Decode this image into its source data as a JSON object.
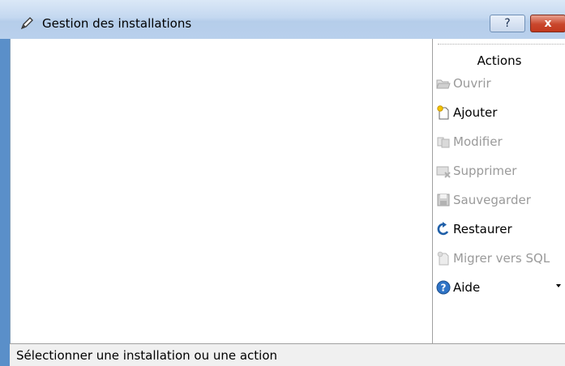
{
  "window": {
    "title": "Gestion des installations",
    "help_glyph": "?",
    "close_glyph": "x"
  },
  "actions": {
    "header": "Actions",
    "items": [
      {
        "label": "Ouvrir",
        "icon": "open-folder-icon",
        "enabled": false
      },
      {
        "label": "Ajouter",
        "icon": "new-document-icon",
        "enabled": true
      },
      {
        "label": "Modifier",
        "icon": "edit-document-icon",
        "enabled": false
      },
      {
        "label": "Supprimer",
        "icon": "delete-icon",
        "enabled": false
      },
      {
        "label": "Sauvegarder",
        "icon": "save-disk-icon",
        "enabled": false
      },
      {
        "label": "Restaurer",
        "icon": "restore-arrow-icon",
        "enabled": true
      },
      {
        "label": "Migrer vers SQL",
        "icon": "migrate-document-icon",
        "enabled": false
      },
      {
        "label": "Aide",
        "icon": "help-circle-icon",
        "enabled": true,
        "has_dropdown": true
      }
    ]
  },
  "status": {
    "text": "Sélectionner une installation ou une action"
  },
  "colors": {
    "titlebar": "#c4d8f0",
    "frame": "#5a8fc9",
    "disabled_text": "#9a9a9a",
    "close_button": "#c9462c"
  }
}
